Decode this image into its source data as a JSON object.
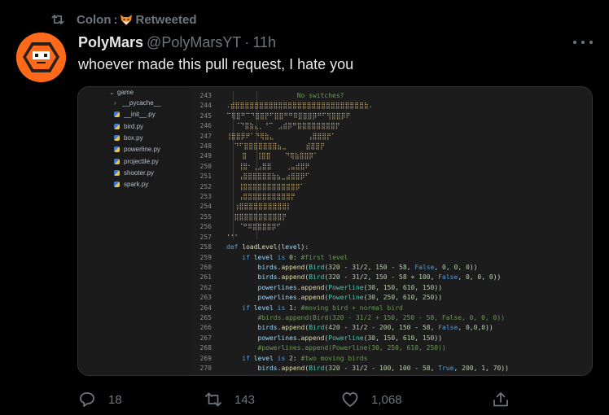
{
  "retweet": {
    "user": "Colon",
    "separator": ":",
    "label": "Retweeted"
  },
  "tweet": {
    "name": "PolyMars",
    "handle": "@PolyMarsYT",
    "time": "11h",
    "text": "whoever made this pull request, I hate you"
  },
  "explorer": {
    "folder": "game",
    "items": [
      {
        "label": "__pycache__",
        "icon": "chevron-right-icon"
      },
      {
        "label": "__init__.py",
        "icon": "python-file-icon"
      },
      {
        "label": "bird.py",
        "icon": "python-file-icon"
      },
      {
        "label": "box.py",
        "icon": "python-file-icon"
      },
      {
        "label": "powerline.py",
        "icon": "python-file-icon"
      },
      {
        "label": "projectile.py",
        "icon": "python-file-icon"
      },
      {
        "label": "shooter.py",
        "icon": "python-file-icon"
      },
      {
        "label": "spark.py",
        "icon": "python-file-icon"
      }
    ]
  },
  "code": {
    "line_numbers": [
      "243",
      "244",
      "245",
      "246",
      "247",
      "248",
      "249",
      "250",
      "251",
      "252",
      "253",
      "254",
      "255",
      "256",
      "257",
      "258",
      "259",
      "260",
      "261",
      "262",
      "263",
      "264",
      "265",
      "266",
      "267",
      "268",
      "269",
      "270"
    ],
    "comment_header": "No switches?",
    "ascii_art": [
      ".⣾⣿⣿⣿⣿⣿⣿⣿⣿⣿⣿⣿⣿⣿⣿⣿⣿⣿⣿⣿⣿⣿⣿⣿⣿⣿⣿⣿⣷.",
      "⠉⢿⣿⠛⠉⠙⣿⣿⡟⠋⣿⣿⠛⠛⠿⣿⣿⣿⡿⠛⠋⢻⣿⣿⡿⠟",
      " ⠀⠈⠙⣿⣷⣄⡀⠘⠉⠀⣠⣾⡿⠛⣿⣿⣿⣿⣿⣿⣿⣿⡟",
      "⢸⣿⣿⡿⠟⠁⠙⢿⣷⣄⠀⠀⠀⠀⠀⠀⠀⢠⣿⣿⣿⡟⠁",
      "  ⠙⠋⣿⣿⣿⣿⣿⣿⣿⣦⣀⠀⠀⠀⠀⣾⣿⣿⡟",
      "    ⣿⠀⠀⢸⣿⣿⠀⠀⠀⠙⢿⣷⣿⣿⡿⠁",
      "   ⢸⣿⠂⢀⣠⣿⣿⠀⠀⠀⢀⣤⣾⣿⠟",
      "   ⢠⣿⣿⣿⣿⣿⣿⣷⣦⣀⣴⣿⣿⡿⠋",
      "   ⢸⣿⣿⣿⣿⣿⣿⣿⣿⣿⣿⣿⡿⠁",
      "   ⢠⣿⣿⣿⣿⣿⣿⣿⣿⣿⣿⡟",
      "  ⢰⣿⣿⣿⣿⣿⣿⣿⣿⣿⣿⡇",
      "  ⣿⣿⣿⣿⣿⣿⣿⣿⣿⣿⡟",
      "   ⠈⠛⠿⣿⣿⣿⣿⡿⠋"
    ],
    "ellipsis": "'''",
    "lines": [
      {
        "tokens": [
          [
            "kw",
            "def "
          ],
          [
            "fn",
            "loadLevel"
          ],
          [
            "",
            "("
          ],
          [
            "var",
            "level"
          ],
          [
            "",
            "):"
          ]
        ]
      },
      {
        "tokens": [
          [
            "",
            "    "
          ],
          [
            "kw",
            "if "
          ],
          [
            "var",
            "level "
          ],
          [
            "kw",
            "is "
          ],
          [
            "num",
            "0"
          ],
          [
            "",
            ": "
          ],
          [
            "cm",
            "#first level"
          ]
        ]
      },
      {
        "tokens": [
          [
            "",
            "        "
          ],
          [
            "var",
            "birds"
          ],
          [
            "",
            "."
          ],
          [
            "fn",
            "append"
          ],
          [
            "",
            "("
          ],
          [
            "cls",
            "Bird"
          ],
          [
            "",
            "("
          ],
          [
            "num",
            "320"
          ],
          [
            "",
            " - "
          ],
          [
            "num",
            "31"
          ],
          [
            "",
            "/"
          ],
          [
            "num",
            "2"
          ],
          [
            "",
            ", "
          ],
          [
            "num",
            "150"
          ],
          [
            "",
            " - "
          ],
          [
            "num",
            "58"
          ],
          [
            "",
            ", "
          ],
          [
            "bool",
            "False"
          ],
          [
            "",
            ", "
          ],
          [
            "num",
            "0"
          ],
          [
            "",
            ", "
          ],
          [
            "num",
            "0"
          ],
          [
            "",
            ", "
          ],
          [
            "num",
            "0"
          ],
          [
            "",
            "))"
          ]
        ]
      },
      {
        "tokens": [
          [
            "",
            "        "
          ],
          [
            "var",
            "birds"
          ],
          [
            "",
            "."
          ],
          [
            "fn",
            "append"
          ],
          [
            "",
            "("
          ],
          [
            "cls",
            "Bird"
          ],
          [
            "",
            "("
          ],
          [
            "num",
            "320"
          ],
          [
            "",
            " - "
          ],
          [
            "num",
            "31"
          ],
          [
            "",
            "/"
          ],
          [
            "num",
            "2"
          ],
          [
            "",
            ", "
          ],
          [
            "num",
            "150"
          ],
          [
            "",
            " - "
          ],
          [
            "num",
            "58"
          ],
          [
            "",
            " + "
          ],
          [
            "num",
            "100"
          ],
          [
            "",
            ", "
          ],
          [
            "bool",
            "False"
          ],
          [
            "",
            ", "
          ],
          [
            "num",
            "0"
          ],
          [
            "",
            ", "
          ],
          [
            "num",
            "0"
          ],
          [
            "",
            ", "
          ],
          [
            "num",
            "0"
          ],
          [
            "",
            "))"
          ]
        ]
      },
      {
        "tokens": [
          [
            "",
            "        "
          ],
          [
            "var",
            "powerlines"
          ],
          [
            "",
            "."
          ],
          [
            "fn",
            "append"
          ],
          [
            "",
            "("
          ],
          [
            "cls",
            "Powerline"
          ],
          [
            "",
            "("
          ],
          [
            "num",
            "30"
          ],
          [
            "",
            ", "
          ],
          [
            "num",
            "150"
          ],
          [
            "",
            ", "
          ],
          [
            "num",
            "610"
          ],
          [
            "",
            ", "
          ],
          [
            "num",
            "150"
          ],
          [
            "",
            "))"
          ]
        ]
      },
      {
        "tokens": [
          [
            "",
            "        "
          ],
          [
            "var",
            "powerlines"
          ],
          [
            "",
            "."
          ],
          [
            "fn",
            "append"
          ],
          [
            "",
            "("
          ],
          [
            "cls",
            "Powerline"
          ],
          [
            "",
            "("
          ],
          [
            "num",
            "30"
          ],
          [
            "",
            ", "
          ],
          [
            "num",
            "250"
          ],
          [
            "",
            ", "
          ],
          [
            "num",
            "610"
          ],
          [
            "",
            ", "
          ],
          [
            "num",
            "250"
          ],
          [
            "",
            "))"
          ]
        ]
      },
      {
        "tokens": [
          [
            "",
            "    "
          ],
          [
            "kw",
            "if "
          ],
          [
            "var",
            "level "
          ],
          [
            "kw",
            "is "
          ],
          [
            "num",
            "1"
          ],
          [
            "",
            ": "
          ],
          [
            "cm",
            "#moving bird + normal bird"
          ]
        ]
      },
      {
        "tokens": [
          [
            "",
            "        "
          ],
          [
            "cm",
            "#birds.append(Bird(320 - 31/2 + 150, 250 - 58, False, 0, 0, 0))"
          ]
        ]
      },
      {
        "tokens": [
          [
            "",
            "        "
          ],
          [
            "var",
            "birds"
          ],
          [
            "",
            "."
          ],
          [
            "fn",
            "append"
          ],
          [
            "",
            "("
          ],
          [
            "cls",
            "Bird"
          ],
          [
            "",
            "("
          ],
          [
            "num",
            "420"
          ],
          [
            "",
            " - "
          ],
          [
            "num",
            "31"
          ],
          [
            "",
            "/"
          ],
          [
            "num",
            "2"
          ],
          [
            "",
            " - "
          ],
          [
            "num",
            "200"
          ],
          [
            "",
            ", "
          ],
          [
            "num",
            "150"
          ],
          [
            "",
            " - "
          ],
          [
            "num",
            "58"
          ],
          [
            "",
            ", "
          ],
          [
            "bool",
            "False"
          ],
          [
            "",
            ", "
          ],
          [
            "num",
            "0"
          ],
          [
            "",
            ","
          ],
          [
            "num",
            "0"
          ],
          [
            "",
            ","
          ],
          [
            "num",
            "0"
          ],
          [
            "",
            "))"
          ]
        ]
      },
      {
        "tokens": [
          [
            "",
            "        "
          ],
          [
            "var",
            "powerlines"
          ],
          [
            "",
            "."
          ],
          [
            "fn",
            "append"
          ],
          [
            "",
            "("
          ],
          [
            "cls",
            "Powerline"
          ],
          [
            "",
            "("
          ],
          [
            "num",
            "30"
          ],
          [
            "",
            ", "
          ],
          [
            "num",
            "150"
          ],
          [
            "",
            ", "
          ],
          [
            "num",
            "610"
          ],
          [
            "",
            ", "
          ],
          [
            "num",
            "150"
          ],
          [
            "",
            "))"
          ]
        ]
      },
      {
        "tokens": [
          [
            "",
            "        "
          ],
          [
            "cm",
            "#powerlines.append(Powerline(30, 250, 610, 250))"
          ]
        ]
      },
      {
        "tokens": [
          [
            "",
            "    "
          ],
          [
            "kw",
            "if "
          ],
          [
            "var",
            "level "
          ],
          [
            "kw",
            "is "
          ],
          [
            "num",
            "2"
          ],
          [
            "",
            ": "
          ],
          [
            "cm",
            "#two moving birds"
          ]
        ]
      },
      {
        "tokens": [
          [
            "",
            "        "
          ],
          [
            "var",
            "birds"
          ],
          [
            "",
            "."
          ],
          [
            "fn",
            "append"
          ],
          [
            "",
            "("
          ],
          [
            "cls",
            "Bird"
          ],
          [
            "",
            "("
          ],
          [
            "num",
            "320"
          ],
          [
            "",
            " - "
          ],
          [
            "num",
            "31"
          ],
          [
            "",
            "/"
          ],
          [
            "num",
            "2"
          ],
          [
            "",
            " - "
          ],
          [
            "num",
            "100"
          ],
          [
            "",
            ", "
          ],
          [
            "num",
            "100"
          ],
          [
            "",
            " - "
          ],
          [
            "num",
            "58"
          ],
          [
            "",
            ", "
          ],
          [
            "bool",
            "True"
          ],
          [
            "",
            ", "
          ],
          [
            "num",
            "200"
          ],
          [
            "",
            ", "
          ],
          [
            "num",
            "1"
          ],
          [
            "",
            ", "
          ],
          [
            "num",
            "70"
          ],
          [
            "",
            "))"
          ]
        ]
      }
    ]
  },
  "actions": {
    "reply": {
      "count": "18",
      "icon": "reply-icon"
    },
    "retweet": {
      "count": "143",
      "icon": "retweet-icon"
    },
    "like": {
      "count": "1,068",
      "icon": "heart-icon"
    },
    "share": {
      "icon": "share-icon"
    }
  },
  "colors": {
    "background": "#000000",
    "muted": "#6e767d",
    "avatar": "#ff6a1a",
    "code_bg": "#1c1c1c"
  }
}
